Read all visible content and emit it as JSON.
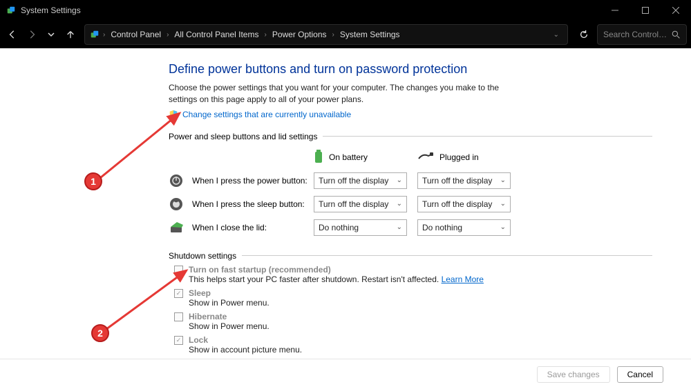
{
  "titlebar": {
    "title": "System Settings"
  },
  "breadcrumb": {
    "items": [
      "Control Panel",
      "All Control Panel Items",
      "Power Options",
      "System Settings"
    ]
  },
  "search": {
    "placeholder": "Search Control P..."
  },
  "page": {
    "heading": "Define power buttons and turn on password protection",
    "intro": "Choose the power settings that you want for your computer. The changes you make to the settings on this page apply to all of your power plans.",
    "change_link": "Change settings that are currently unavailable",
    "section_buttons_title": "Power and sleep buttons and lid settings",
    "col_battery": "On battery",
    "col_plugged": "Plugged in",
    "rows": [
      {
        "label": "When I press the power button:",
        "battery": "Turn off the display",
        "plugged": "Turn off the display"
      },
      {
        "label": "When I press the sleep button:",
        "battery": "Turn off the display",
        "plugged": "Turn off the display"
      },
      {
        "label": "When I close the lid:",
        "battery": "Do nothing",
        "plugged": "Do nothing"
      }
    ],
    "section_shutdown_title": "Shutdown settings",
    "opts": [
      {
        "title": "Turn on fast startup (recommended)",
        "desc": "This helps start your PC faster after shutdown. Restart isn't affected. ",
        "learn": "Learn More",
        "checked": false,
        "disabled": true
      },
      {
        "title": "Sleep",
        "desc": "Show in Power menu.",
        "checked": true,
        "disabled": true
      },
      {
        "title": "Hibernate",
        "desc": "Show in Power menu.",
        "checked": false,
        "disabled": true
      },
      {
        "title": "Lock",
        "desc": "Show in account picture menu.",
        "checked": true,
        "disabled": true
      }
    ]
  },
  "footer": {
    "save": "Save changes",
    "cancel": "Cancel"
  },
  "annotations": {
    "badge1": "1",
    "badge2": "2"
  }
}
